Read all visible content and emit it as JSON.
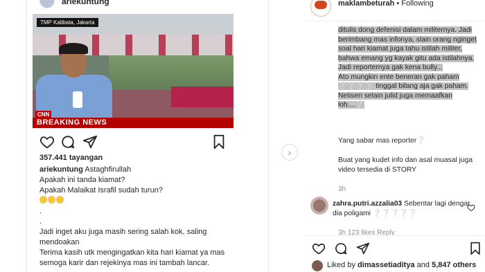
{
  "left_post": {
    "username": "ariekuntung",
    "video": {
      "location_label": "TMP Kalibata, Jakarta",
      "network_logo": "CNN",
      "banner": "BREAKING NEWS"
    },
    "views": "357.441 tayangan",
    "caption": {
      "username": "ariekuntung",
      "lines": [
        "Astaghfirullah",
        "Apakah ini tanda kiamat?",
        "Apakah Malaikat Israfil sudah turun?",
        ".",
        ".",
        "Jadi inget aku juga masih sering salah kok, saling mendoakan",
        "Terima kasih utk mengingatkan kita hari kiamat ya mas",
        "semoga karir dan rejekinya mas ini tambah lancar."
      ]
    },
    "icons": [
      "heart-icon",
      "comment-icon",
      "share-icon",
      "bookmark-icon"
    ]
  },
  "right_post": {
    "username": "maklambeturah",
    "separator": "•",
    "follow_status": "Following",
    "highlighted_text": [
      "ditulis dong defenisi dalam militernya. Jadi berimbang mas infonya, slain orang nginget soal hari kiamat juga tahu istilah militer, bahwa emang yg kayak gitu ada istilahnya. Jadi reporternya gak kena bully...",
      "Ato mungkin ente beneran gak paham ❔❔❔❔ tinggal bilang aja gak paham. Netisen selain julid juga memaafkan loh....❔"
    ],
    "text_1": "Yang sabar mas reporter❔",
    "text_2": "Buat yang kudet info dan asal muasal juga video tersedia di STORY",
    "time_ago": "3h",
    "comment": {
      "username": "zahra.putri.azzalia03",
      "text": "Sebentar lagi dengar dia poligami ❔❔❔❔❔",
      "meta": "3h   123 likes   Reply"
    },
    "liked_by": {
      "prefix": "Liked by",
      "user": "dimassetiaditya",
      "suffix": "and",
      "others": "5,847 others"
    },
    "icons": [
      "heart-icon",
      "comment-icon",
      "share-icon",
      "bookmark-icon"
    ]
  }
}
